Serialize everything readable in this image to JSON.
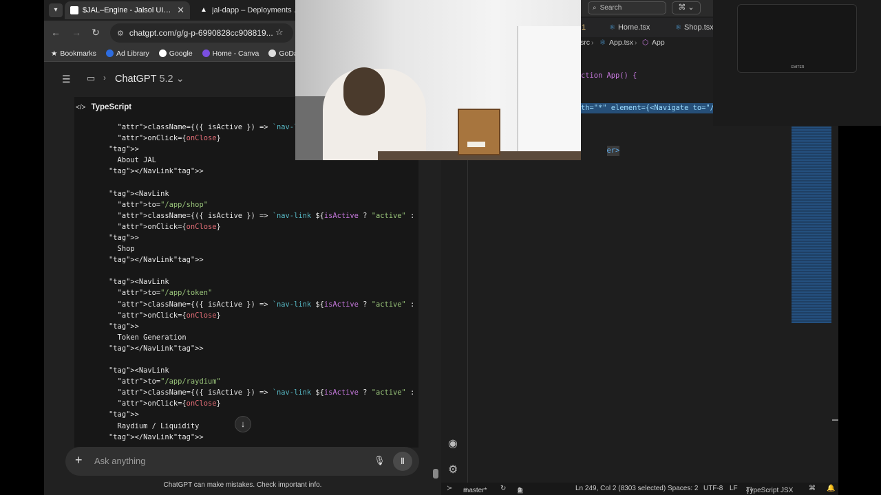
{
  "browser": {
    "tabs": [
      {
        "label": "$JAL–Engine - Jalsol UI Impro",
        "active": true
      },
      {
        "label": "jal-dapp – Deployments – Ve",
        "active": false
      }
    ],
    "url": "chatgpt.com/g/g-p-6990828cc908819...",
    "bookmarks": [
      "Bookmarks",
      "Ad Library",
      "Google",
      "Home - Canva",
      "GoDadd"
    ]
  },
  "chat": {
    "model": "ChatGPT",
    "version": "5.2",
    "code_language": "TypeScript",
    "code_lines": [
      "          className={({ isActive }) => `nav-link ${",
      "          onClick={onClose}",
      "        >",
      "          About JAL",
      "        </NavLink>",
      "",
      "        <NavLink",
      "          to=\"/app/shop\"",
      "          className={({ isActive }) => `nav-link ${isActive ? \"active\" : \"\"}`}",
      "          onClick={onClose}",
      "        >",
      "          Shop",
      "        </NavLink>",
      "",
      "        <NavLink",
      "          to=\"/app/token\"",
      "          className={({ isActive }) => `nav-link ${isActive ? \"active\" : \"\"}`}",
      "          onClick={onClose}",
      "        >",
      "          Token Generation",
      "        </NavLink>",
      "",
      "        <NavLink",
      "          to=\"/app/raydium\"",
      "          className={({ isActive }) => `nav-link ${isActive ? \"active\" : \"\"}`}",
      "          onClick={onClose}",
      "        >",
      "          Raydium / Liquidity",
      "        </NavLink>"
    ],
    "composer_placeholder": "Ask anything",
    "disclaimer": "ChatGPT can make mistakes. Check important info."
  },
  "vscode": {
    "search_placeholder": "Search",
    "tabs": [
      {
        "label": "1"
      },
      {
        "label": "Home.tsx"
      },
      {
        "label": "Shop.tsx"
      }
    ],
    "breadcrumb": [
      "src",
      "App.tsx",
      "App"
    ],
    "code_lines": [
      "ction App() {",
      "th=\"*\" element={<Navigate to=\"/\"",
      "",
      "er>"
    ],
    "status": {
      "branch": "master*",
      "errors": "0",
      "warnings": "1",
      "position": "Ln 249, Col 2 (8303 selected)",
      "spaces": "Spaces: 2",
      "encoding": "UTF-8",
      "eol": "LF",
      "language": "TypeScript JSX"
    }
  },
  "preview": {
    "label": "EMITER"
  }
}
